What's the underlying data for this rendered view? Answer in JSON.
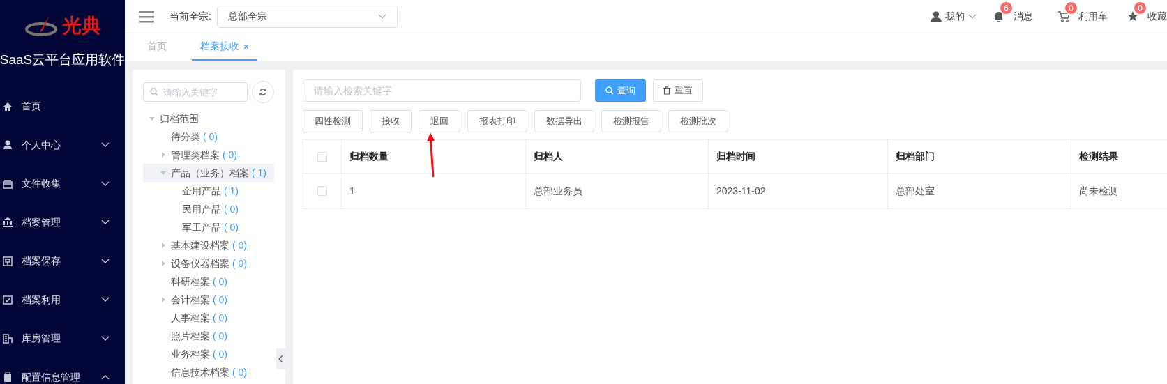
{
  "logo": {
    "brand": "光典",
    "title": "SaaS云平台应用软件"
  },
  "nav": [
    {
      "label": "首页"
    },
    {
      "label": "个人中心",
      "expanded": false
    },
    {
      "label": "文件收集",
      "expanded": false
    },
    {
      "label": "档案管理",
      "expanded": false
    },
    {
      "label": "档案保存",
      "expanded": false
    },
    {
      "label": "档案利用",
      "expanded": false
    },
    {
      "label": "库房管理",
      "expanded": false
    },
    {
      "label": "配置信息管理",
      "expanded": true
    }
  ],
  "header": {
    "fonds_label": "当前全宗:",
    "fonds_value": "总部全宗",
    "user": "我的",
    "shortcuts": [
      {
        "label": "消息",
        "badge": "6"
      },
      {
        "label": "利用车",
        "badge": "0"
      },
      {
        "label": "收藏",
        "badge": "0"
      }
    ]
  },
  "tabs": [
    {
      "label": "首页",
      "selected": false,
      "closable": false
    },
    {
      "label": "档案接收",
      "selected": true,
      "closable": true
    }
  ],
  "tree": {
    "placeholder": "请输入关键字",
    "nodes": [
      {
        "label": "归档范围",
        "expanded": true,
        "selected": false,
        "children": [
          {
            "label": "待分类",
            "count": "( 0)",
            "selected": false
          },
          {
            "label": "管理类档案",
            "count": "( 0)",
            "expanded": false,
            "selected": false
          },
          {
            "label": "产品（业务）档案",
            "count": "( 1)",
            "expanded": true,
            "selected": true,
            "children": [
              {
                "label": "企用产品",
                "count": "( 1)",
                "selected": false
              },
              {
                "label": "民用产品",
                "count": "( 0)",
                "selected": false
              },
              {
                "label": "军工产品",
                "count": "( 0)",
                "selected": false
              }
            ]
          },
          {
            "label": "基本建设档案",
            "count": "( 0)",
            "expanded": false,
            "selected": false
          },
          {
            "label": "设备仪器档案",
            "count": "( 0)",
            "expanded": false,
            "selected": false
          },
          {
            "label": "科研档案",
            "count": "( 0)",
            "selected": false
          },
          {
            "label": "会计档案",
            "count": "( 0)",
            "expanded": false,
            "selected": false
          },
          {
            "label": "人事档案",
            "count": "( 0)",
            "selected": false
          },
          {
            "label": "照片档案",
            "count": "( 0)",
            "selected": false
          },
          {
            "label": "业务档案",
            "count": "( 0)",
            "selected": false
          },
          {
            "label": "信息技术档案",
            "count": "( 0)",
            "selected": false
          }
        ]
      }
    ]
  },
  "main": {
    "placeholder": "请输入检索关键字",
    "query": "查询",
    "reset": "重置",
    "actions": [
      "四性检测",
      "接收",
      "退回",
      "报表打印",
      "数据导出",
      "检测报告",
      "检测批次"
    ],
    "table": {
      "all_checked": false,
      "columns": [
        "归档数量",
        "归档人",
        "归档时间",
        "归档部门",
        "检测结果"
      ],
      "rows": [
        {
          "checked": false,
          "cells": [
            "1",
            "总部业务员",
            "2023-11-02",
            "总部处室",
            "尚未检测"
          ]
        }
      ]
    }
  }
}
